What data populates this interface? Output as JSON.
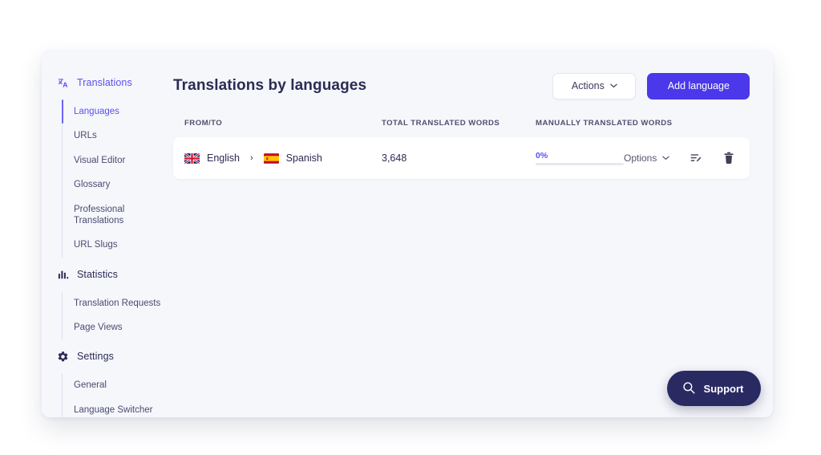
{
  "sidebar": {
    "groups": [
      {
        "icon": "translate-icon",
        "label": "Translations",
        "items": [
          {
            "label": "Languages",
            "active": true
          },
          {
            "label": "URLs",
            "active": false
          },
          {
            "label": "Visual Editor",
            "active": false
          },
          {
            "label": "Glossary",
            "active": false
          },
          {
            "label": "Professional Translations",
            "active": false
          },
          {
            "label": "URL Slugs",
            "active": false
          }
        ]
      },
      {
        "icon": "bar-chart-icon",
        "label": "Statistics",
        "items": [
          {
            "label": "Translation Requests",
            "active": false
          },
          {
            "label": "Page Views",
            "active": false
          }
        ]
      },
      {
        "icon": "gear-icon",
        "label": "Settings",
        "items": [
          {
            "label": "General",
            "active": false
          },
          {
            "label": "Language Switcher",
            "active": false
          }
        ]
      }
    ]
  },
  "header": {
    "title": "Translations by languages",
    "actions_label": "Actions",
    "actions_chevron": "chevron-down-icon",
    "add_language_label": "Add language"
  },
  "table": {
    "columns": {
      "from_to": "FROM/TO",
      "total_translated_words": "TOTAL TRANSLATED WORDS",
      "manually_translated_words": "MANUALLY TRANSLATED WORDS"
    },
    "rows": [
      {
        "source_language": "English",
        "source_flag": "flag-united-kingdom",
        "arrow": "›",
        "target_language": "Spanish",
        "target_flag": "flag-spain",
        "total_translated_words": "3,648",
        "manual_percent_label": "0%",
        "manual_percent_value": 0,
        "options_label": "Options",
        "edit_icon": "edit-lines-icon",
        "delete_icon": "trash-icon"
      }
    ]
  },
  "support": {
    "label": "Support",
    "icon": "search-icon"
  },
  "colors": {
    "accent": "#4a38ea",
    "accent_text": "#5a4ff3",
    "support_bg": "#2a2a63",
    "app_bg": "#f6f7fb",
    "card_bg": "#ffffff",
    "title_text": "#2b2b55"
  }
}
